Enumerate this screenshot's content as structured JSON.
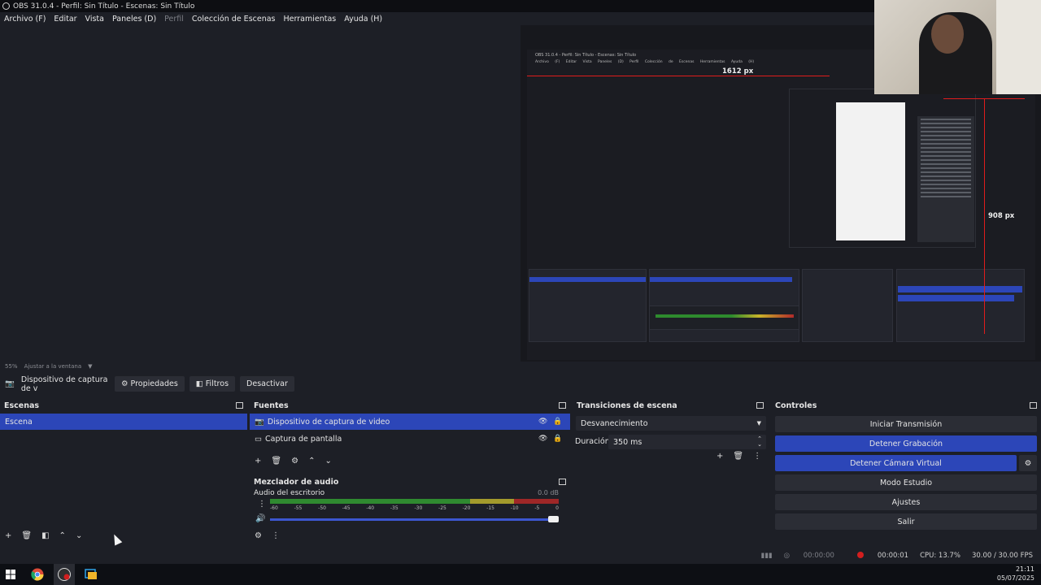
{
  "window": {
    "title": "OBS 31.0.4 - Perfil: Sin Título - Escenas: Sin Título"
  },
  "menu": [
    "Archivo (F)",
    "Editar",
    "Vista",
    "Paneles (D)",
    "Perfil",
    "Colección de Escenas",
    "Herramientas",
    "Ayuda (H)"
  ],
  "preview": {
    "width_label": "1612 px",
    "height_label": "908 px",
    "inner_title": "OBS 31.0.4 - Perfil: Sin Título - Escenas: Sin Título",
    "inner_menu": "Archivo (F) Editar Vista Paneles (D) Perfil Colección de Escenas Herramientas Ayuda (H)"
  },
  "zoom": {
    "level": "55%",
    "mode": "Ajustar a la ventana"
  },
  "source_toolbar": {
    "source_name": "Dispositivo de captura de v",
    "properties": "Propiedades",
    "filters": "Filtros",
    "deactivate": "Desactivar"
  },
  "scenes": {
    "title": "Escenas",
    "items": [
      "Escena"
    ]
  },
  "sources": {
    "title": "Fuentes",
    "items": [
      "Dispositivo de captura de video",
      "Captura de pantalla"
    ]
  },
  "mixer": {
    "title": "Mezclador de audio",
    "channel": "Audio del escritorio",
    "db": "0.0 dB",
    "ticks": [
      "-60",
      "-55",
      "-50",
      "-45",
      "-40",
      "-35",
      "-30",
      "-25",
      "-20",
      "-15",
      "-10",
      "-5",
      "0"
    ]
  },
  "transitions": {
    "title": "Transiciones de escena",
    "selected": "Desvanecimiento",
    "duration_label": "Duración",
    "duration_value": "350 ms"
  },
  "controls": {
    "title": "Controles",
    "start_stream": "Iniciar Transmisión",
    "stop_recording": "Detener Grabación",
    "stop_virtualcam": "Detener Cámara Virtual",
    "studio_mode": "Modo Estudio",
    "settings": "Ajustes",
    "exit": "Salir"
  },
  "status": {
    "stream_time": "00:00:00",
    "rec_time": "00:00:01",
    "cpu": "CPU: 13.7%",
    "fps": "30.00 / 30.00 FPS"
  },
  "tray": {
    "time": "21:11",
    "date": "05/07/2025"
  },
  "colors": {
    "accent": "#2c46b8",
    "background": "#1d1f26",
    "recording": "#d21e1e"
  }
}
